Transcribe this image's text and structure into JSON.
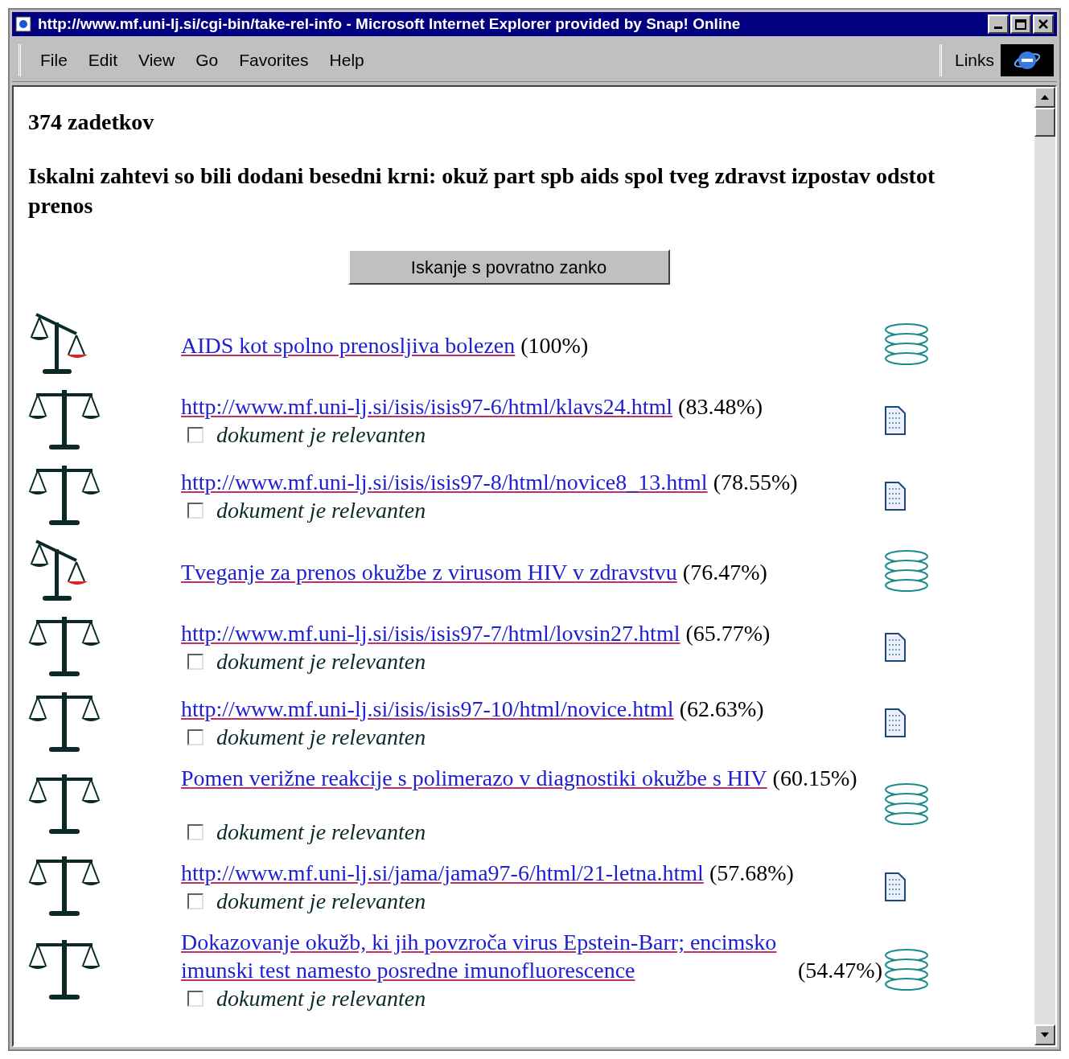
{
  "window": {
    "title": "http://www.mf.uni-lj.si/cgi-bin/take-rel-info - Microsoft Internet Explorer provided by Snap! Online"
  },
  "menu": [
    {
      "label": "File"
    },
    {
      "label": "Edit"
    },
    {
      "label": "View"
    },
    {
      "label": "Go"
    },
    {
      "label": "Favorites"
    },
    {
      "label": "Help"
    }
  ],
  "links_label": "Links",
  "hit_count": "374 zadetkov",
  "query_note": "Iskalni zahtevi so bili dodani besedni krni: okuž part spb aids spol tveg zdravst izpostav odstot prenos",
  "feedback_button": "Iskanje s povratno zanko",
  "results": [
    {
      "scale_icon": {
        "kind": "tilted"
      },
      "link": "AIDS kot spolno prenosljiva bolezen",
      "score": "(100%)",
      "source_icon": {
        "kind": "database"
      }
    },
    {
      "scale_icon": {
        "kind": "balanced"
      },
      "link": "http://www.mf.uni-lj.si/isis/isis97-6/html/klavs24.html",
      "score": "(83.48%)",
      "source_icon": {
        "kind": "document"
      },
      "relevant": {
        "label": "dokument je relevanten",
        "checked": false
      }
    },
    {
      "scale_icon": {
        "kind": "balanced"
      },
      "link": "http://www.mf.uni-lj.si/isis/isis97-8/html/novice8_13.html",
      "score": "(78.55%)",
      "source_icon": {
        "kind": "document"
      },
      "relevant": {
        "label": "dokument je relevanten",
        "checked": false
      }
    },
    {
      "scale_icon": {
        "kind": "tilted"
      },
      "link": "Tveganje za prenos okužbe z virusom HIV v zdravstvu",
      "score": "(76.47%)",
      "source_icon": {
        "kind": "database"
      }
    },
    {
      "scale_icon": {
        "kind": "balanced"
      },
      "link": "http://www.mf.uni-lj.si/isis/isis97-7/html/lovsin27.html",
      "score": "(65.77%)",
      "source_icon": {
        "kind": "document"
      },
      "relevant": {
        "label": "dokument je relevanten",
        "checked": false
      }
    },
    {
      "scale_icon": {
        "kind": "balanced"
      },
      "link": "http://www.mf.uni-lj.si/isis/isis97-10/html/novice.html",
      "score": "(62.63%)",
      "source_icon": {
        "kind": "document"
      },
      "relevant": {
        "label": "dokument je relevanten",
        "checked": false
      }
    },
    {
      "scale_icon": {
        "kind": "balanced"
      },
      "link": "Pomen verižne reakcije s polimerazo v diagnostiki okužbe s HIV",
      "score": "(60.15%)",
      "source_icon": {
        "kind": "database"
      },
      "relevant": {
        "label": "dokument je relevanten",
        "checked": false
      }
    },
    {
      "scale_icon": {
        "kind": "balanced"
      },
      "link": "http://www.mf.uni-lj.si/jama/jama97-6/html/21-letna.html",
      "score": "(57.68%)",
      "source_icon": {
        "kind": "document"
      },
      "relevant": {
        "label": "dokument je relevanten",
        "checked": false
      }
    },
    {
      "scale_icon": {
        "kind": "balanced"
      },
      "link": "Dokazovanje okužb, ki jih povzroča virus Epstein-Barr; encimsko imunski test namesto posredne imunofluorescence",
      "score": "(54.47%)",
      "source_icon": {
        "kind": "database"
      },
      "relevant": {
        "label": "dokument je relevanten",
        "checked": false
      }
    }
  ]
}
